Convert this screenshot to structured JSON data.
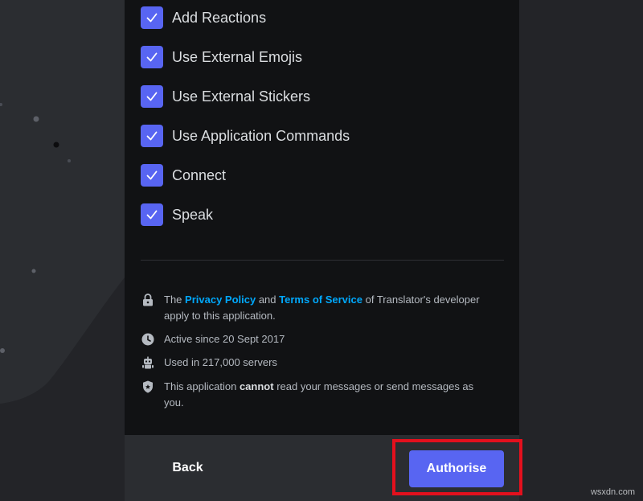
{
  "permissions": [
    {
      "label": "Add Reactions",
      "checked": true
    },
    {
      "label": "Use External Emojis",
      "checked": true
    },
    {
      "label": "Use External Stickers",
      "checked": true
    },
    {
      "label": "Use Application Commands",
      "checked": true
    },
    {
      "label": "Connect",
      "checked": true
    },
    {
      "label": "Speak",
      "checked": true
    }
  ],
  "info": {
    "policy": {
      "prefix": "The",
      "privacy_link": "Privacy Policy",
      "and": "and",
      "terms_link": "Terms of Service",
      "suffix": "of Translator's developer apply to this application."
    },
    "active_since": "Active since 20 Sept 2017",
    "servers": "Used in 217,000 servers",
    "messages": {
      "prefix": "This application",
      "emphasis": "cannot",
      "suffix": "read your messages or send messages as you."
    }
  },
  "footer": {
    "back_label": "Back",
    "authorise_label": "Authorise"
  },
  "watermark": "wsxdn.com",
  "colors": {
    "accent": "#5865f2",
    "link": "#00a8fc",
    "highlight": "#e3101d"
  }
}
